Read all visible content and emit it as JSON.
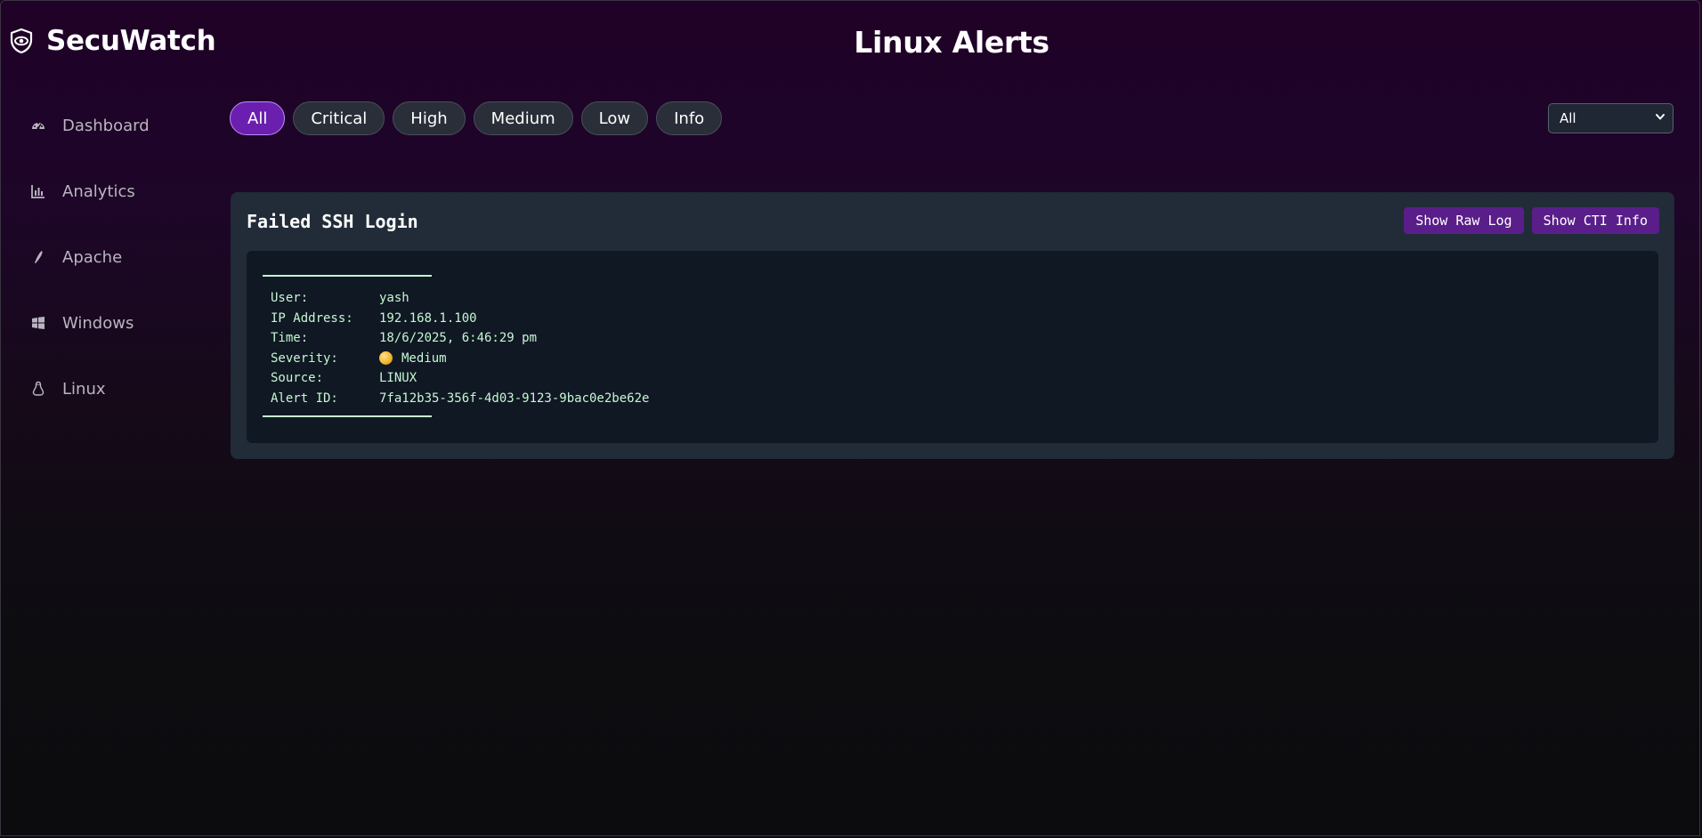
{
  "brand": {
    "name": "SecuWatch",
    "logo_icon": "shield-eye-icon"
  },
  "page": {
    "title": "Linux Alerts"
  },
  "sidebar": {
    "items": [
      {
        "label": "Dashboard",
        "icon": "gauge-icon"
      },
      {
        "label": "Analytics",
        "icon": "bar-chart-icon"
      },
      {
        "label": "Apache",
        "icon": "feather-icon"
      },
      {
        "label": "Windows",
        "icon": "windows-icon"
      },
      {
        "label": "Linux",
        "icon": "linux-icon"
      }
    ]
  },
  "filters": {
    "severity": [
      "All",
      "Critical",
      "High",
      "Medium",
      "Low",
      "Info"
    ],
    "active": "All",
    "select_value": "All"
  },
  "alert": {
    "title": "Failed SSH Login",
    "show_raw_label": "Show Raw Log",
    "show_cti_label": "Show CTI Info",
    "fields": [
      {
        "label": "User:",
        "value": "yash"
      },
      {
        "label": "IP Address:",
        "value": "192.168.1.100"
      },
      {
        "label": "Time:",
        "value": "18/6/2025, 6:46:29 pm"
      },
      {
        "label": "Severity:",
        "value": "Medium",
        "icon": "medium-severity-dot"
      },
      {
        "label": "Source:",
        "value": "LINUX"
      },
      {
        "label": "Alert ID:",
        "value": "7fa12b35-356f-4d03-9123-9bac0e2be62e"
      }
    ]
  },
  "colors": {
    "accent": "#6a1fae",
    "button": "#5a1e8a",
    "card": "#222b38",
    "log_bg": "#101823",
    "log_text": "#c6f7d4",
    "severity_medium": "#f2b632"
  }
}
